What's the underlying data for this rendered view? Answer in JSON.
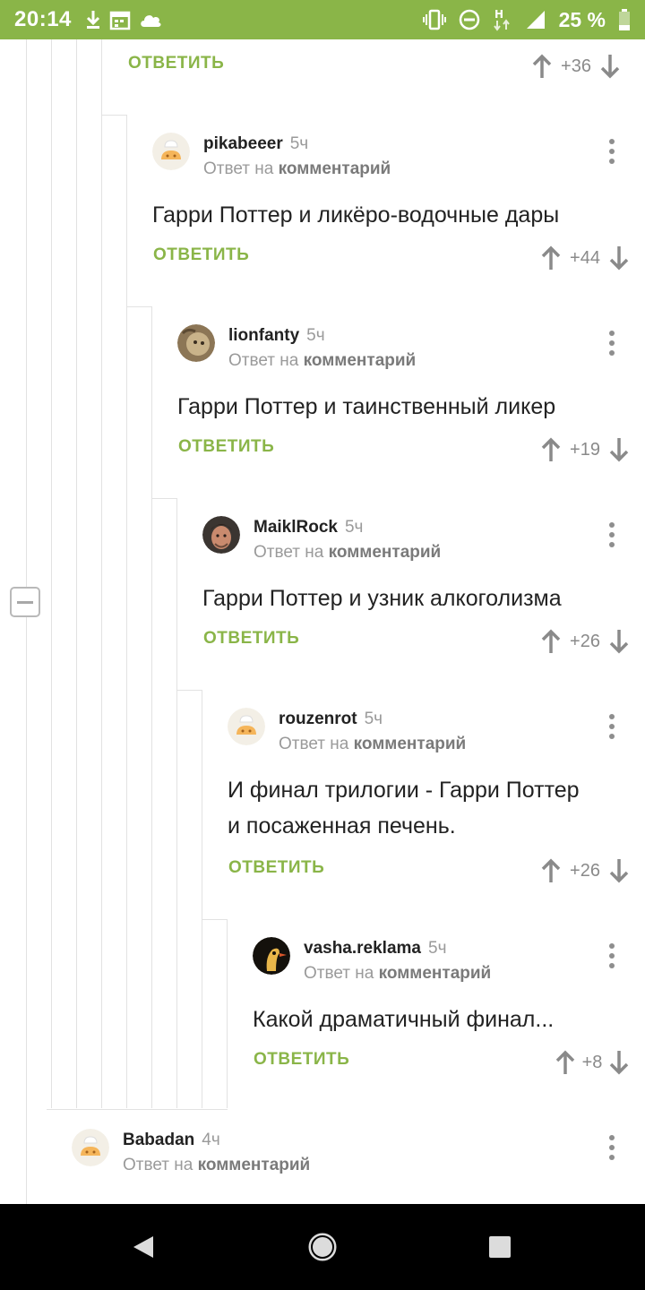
{
  "status_bar": {
    "time": "20:14",
    "battery": "25 %",
    "icons_left": [
      "download-icon",
      "calendar-icon",
      "cloud-icon"
    ],
    "icons_right": [
      "vibrate-icon",
      "dnd-icon",
      "network-h-icon",
      "signal-icon",
      "battery-icon"
    ],
    "bg_color": "#8ab548"
  },
  "theme": {
    "accent": "#8ab548",
    "meta": "#9a9a9a"
  },
  "top_partial": {
    "reply_label": "ОТВЕТИТЬ",
    "score": "+36"
  },
  "comments": [
    {
      "author": "pikabeeer",
      "time": "5ч",
      "reply_prefix": "Ответ на",
      "reply_link": "комментарий",
      "text": [
        "Гарри Поттер и ликёро-водочные дары"
      ],
      "reply_label": "ОТВЕТИТЬ",
      "score": "+44",
      "avatar": "cook-avatar"
    },
    {
      "author": "lionfanty",
      "time": "5ч",
      "reply_prefix": "Ответ на",
      "reply_link": "комментарий",
      "text": [
        "Гарри Поттер и таинственный ликер"
      ],
      "reply_label": "ОТВЕТИТЬ",
      "score": "+19",
      "avatar": "lion-avatar"
    },
    {
      "author": "MaiklRock",
      "time": "5ч",
      "reply_prefix": "Ответ на",
      "reply_link": "комментарий",
      "text": [
        "Гарри Поттер и узник алкоголизма"
      ],
      "reply_label": "ОТВЕТИТЬ",
      "score": "+26",
      "avatar": "face-avatar"
    },
    {
      "author": "rouzenrot",
      "time": "5ч",
      "reply_prefix": "Ответ на",
      "reply_link": "комментарий",
      "text": [
        "И финал трилогии - Гарри Поттер",
        "и посаженная печень."
      ],
      "reply_label": "ОТВЕТИТЬ",
      "score": "+26",
      "avatar": "cook-avatar"
    },
    {
      "author": "vasha.reklama",
      "time": "5ч",
      "reply_prefix": "Ответ на",
      "reply_link": "комментарий",
      "text": [
        "Какой драматичный финал..."
      ],
      "reply_label": "ОТВЕТИТЬ",
      "score": "+8",
      "avatar": "bird-avatar"
    },
    {
      "author": "Babadan",
      "time": "4ч",
      "reply_prefix": "Ответ на",
      "reply_link": "комментарий",
      "text": [],
      "avatar": "cook-avatar"
    }
  ],
  "nav": {
    "back": "back-icon",
    "home": "home-icon",
    "recents": "recents-icon"
  }
}
